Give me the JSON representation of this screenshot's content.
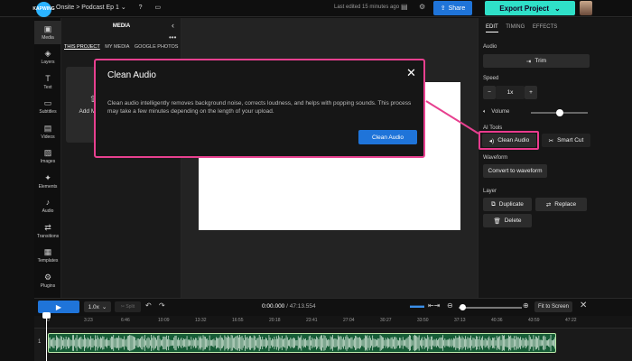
{
  "topbar": {
    "logo_text": "KAPWING",
    "breadcrumb_root": "Onsite",
    "breadcrumb_sep": ">",
    "project_name": "Podcast Ep 1",
    "last_edited": "Last edited 15 minutes ago",
    "share_label": "Share",
    "export_label": "Export Project"
  },
  "rail": {
    "items": [
      {
        "label": "Media",
        "icon": "▣"
      },
      {
        "label": "Layers",
        "icon": "◈"
      },
      {
        "label": "Text",
        "icon": "T"
      },
      {
        "label": "Subtitles",
        "icon": "▭"
      },
      {
        "label": "Videos",
        "icon": "▤"
      },
      {
        "label": "Images",
        "icon": "▨"
      },
      {
        "label": "Elements",
        "icon": "✦"
      },
      {
        "label": "Audio",
        "icon": "♪"
      },
      {
        "label": "Transitions",
        "icon": "⇄"
      },
      {
        "label": "Templates",
        "icon": "▦"
      },
      {
        "label": "Plugins",
        "icon": "⚙"
      }
    ]
  },
  "media": {
    "title": "MEDIA",
    "tabs": [
      "THIS PROJECT",
      "MY MEDIA",
      "GOOGLE PHOTOS"
    ],
    "upload_label": "Add Media"
  },
  "right": {
    "tabs": [
      "EDIT",
      "TIMING",
      "EFFECTS"
    ],
    "audio_label": "Audio",
    "trim_label": "Trim",
    "speed_label": "Speed",
    "speed_value": "1x",
    "volume_label": "Volume",
    "volume_level": 0.5,
    "ai_tools_label": "AI Tools",
    "clean_audio_label": "Clean Audio",
    "smart_cut_label": "Smart Cut",
    "waveform_label": "Waveform",
    "convert_waveform_label": "Convert to waveform",
    "layer_label": "Layer",
    "duplicate_label": "Duplicate",
    "replace_label": "Replace",
    "delete_label": "Delete"
  },
  "modal": {
    "title": "Clean Audio",
    "body": "Clean audio intelligently removes background noise, corrects loudness, and helps with popping sounds. This process may take a few minutes depending on the length of your upload.",
    "button_label": "Clean Audio"
  },
  "timeline": {
    "speed_value": "1.0x",
    "split_label": "✂ Split",
    "current_time": "0:00.000",
    "separator": " / ",
    "total_time": "47:13.554",
    "fit_label": "Fit to Screen",
    "ticks": [
      "0",
      "3:23",
      "6:46",
      "10:09",
      "13:32",
      "16:55",
      "20:18",
      "23:41",
      "27:04",
      "30:27",
      "33:50",
      "37:13",
      "40:36",
      "43:59",
      "47:22"
    ],
    "track_number": "1"
  },
  "colors": {
    "accent_blue": "#1f74d9",
    "export_teal": "#2fe0c8",
    "highlight_pink": "#e7408f",
    "clip_green": "#165c36"
  }
}
